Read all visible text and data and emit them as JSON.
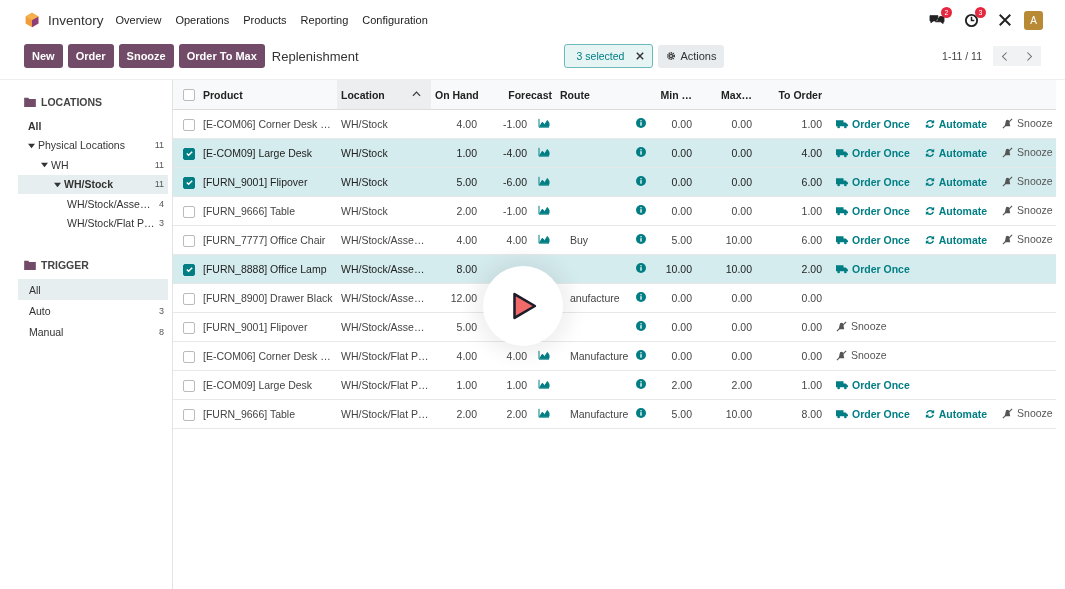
{
  "app": {
    "name": "Inventory"
  },
  "menu": [
    "Overview",
    "Operations",
    "Products",
    "Reporting",
    "Configuration"
  ],
  "systray": {
    "messages_badge": "2",
    "activities_badge": "3",
    "avatar": "A"
  },
  "toolbar": {
    "buttons": [
      "New",
      "Order",
      "Snooze",
      "Order To Max"
    ],
    "title": "Replenishment",
    "selection": "3 selected",
    "actions": "Actions",
    "pager": "1-11 / 11"
  },
  "sidebar": {
    "locations": {
      "title": "LOCATIONS",
      "items": [
        {
          "label": "All",
          "selected": false
        },
        {
          "label": "Physical Locations",
          "count": "11",
          "selected": false,
          "expanded": true,
          "children": [
            {
              "label": "WH",
              "count": "11",
              "selected": false,
              "expanded": true,
              "children": [
                {
                  "label": "WH/Stock",
                  "count": "11",
                  "selected": true,
                  "expanded": true,
                  "children": [
                    {
                      "label": "WH/Stock/Asse…",
                      "count": "4",
                      "selected": false
                    },
                    {
                      "label": "WH/Stock/Flat P…",
                      "count": "3",
                      "selected": false
                    }
                  ]
                }
              ]
            }
          ]
        }
      ]
    },
    "trigger": {
      "title": "TRIGGER",
      "items": [
        {
          "label": "All",
          "selected": true
        },
        {
          "label": "Auto",
          "count": "3",
          "selected": false
        },
        {
          "label": "Manual",
          "count": "8",
          "selected": false
        }
      ]
    }
  },
  "table": {
    "header_checked": false,
    "columns": [
      {
        "label": "Product",
        "sorted": false
      },
      {
        "label": "Location",
        "sorted": true
      },
      {
        "label": "On Hand",
        "sorted": false
      },
      {
        "label": "Forecast",
        "sorted": false
      },
      {
        "label": "Route",
        "sorted": false
      },
      {
        "label": "Min …",
        "sorted": false
      },
      {
        "label": "Max…",
        "sorted": false
      },
      {
        "label": "To Order",
        "sorted": false
      }
    ],
    "rows": [
      {
        "selected": false,
        "product": "[E-COM06] Corner Desk …",
        "location": "WH/Stock",
        "on_hand": "4.00",
        "forecast": "-1.00",
        "chart": true,
        "route": "",
        "min": "0.00",
        "max": "0.00",
        "to_order": "1.00",
        "order_once": "Order Once",
        "automate": "Automate",
        "snooze": "Snooze"
      },
      {
        "selected": true,
        "product": "[E-COM09] Large Desk",
        "location": "WH/Stock",
        "on_hand": "1.00",
        "forecast": "-4.00",
        "chart": true,
        "route": "",
        "min": "0.00",
        "max": "0.00",
        "to_order": "4.00",
        "order_once": "Order Once",
        "automate": "Automate",
        "snooze": "Snooze"
      },
      {
        "selected": true,
        "product": "[FURN_9001] Flipover",
        "location": "WH/Stock",
        "on_hand": "5.00",
        "forecast": "-6.00",
        "chart": true,
        "route": "",
        "min": "0.00",
        "max": "0.00",
        "to_order": "6.00",
        "order_once": "Order Once",
        "automate": "Automate",
        "snooze": "Snooze"
      },
      {
        "selected": false,
        "product": "[FURN_9666] Table",
        "location": "WH/Stock",
        "on_hand": "2.00",
        "forecast": "-1.00",
        "chart": true,
        "route": "",
        "min": "0.00",
        "max": "0.00",
        "to_order": "1.00",
        "order_once": "Order Once",
        "automate": "Automate",
        "snooze": "Snooze"
      },
      {
        "selected": false,
        "product": "[FURN_7777] Office Chair",
        "location": "WH/Stock/Asse…",
        "on_hand": "4.00",
        "forecast": "4.00",
        "chart": true,
        "route": "Buy",
        "min": "5.00",
        "max": "10.00",
        "to_order": "6.00",
        "order_once": "Order Once",
        "automate": "Automate",
        "snooze": "Snooze"
      },
      {
        "selected": true,
        "product": "[FURN_8888] Office Lamp",
        "location": "WH/Stock/Asse…",
        "on_hand": "8.00",
        "forecast": "",
        "chart": false,
        "route": "",
        "min": "10.00",
        "max": "10.00",
        "to_order": "2.00",
        "order_once": "Order Once",
        "automate": "",
        "snooze": ""
      },
      {
        "selected": false,
        "product": "[FURN_8900] Drawer Black",
        "location": "WH/Stock/Asse…",
        "on_hand": "12.00",
        "forecast": "",
        "chart": false,
        "route": "anufacture",
        "min": "0.00",
        "max": "0.00",
        "to_order": "0.00",
        "order_once": "",
        "automate": "",
        "snooze": ""
      },
      {
        "selected": false,
        "product": "[FURN_9001] Flipover",
        "location": "WH/Stock/Asse…",
        "on_hand": "5.00",
        "forecast": "",
        "chart": false,
        "route": "",
        "min": "0.00",
        "max": "0.00",
        "to_order": "0.00",
        "order_once": "",
        "automate": "",
        "snooze": "Snooze"
      },
      {
        "selected": false,
        "product": "[E-COM06] Corner Desk …",
        "location": "WH/Stock/Flat P…",
        "on_hand": "4.00",
        "forecast": "4.00",
        "chart": true,
        "route": "Manufacture",
        "min": "0.00",
        "max": "0.00",
        "to_order": "0.00",
        "order_once": "",
        "automate": "",
        "snooze": "Snooze"
      },
      {
        "selected": false,
        "product": "[E-COM09] Large Desk",
        "location": "WH/Stock/Flat P…",
        "on_hand": "1.00",
        "forecast": "1.00",
        "chart": true,
        "route": "",
        "min": "2.00",
        "max": "2.00",
        "to_order": "1.00",
        "order_once": "Order Once",
        "automate": "",
        "snooze": ""
      },
      {
        "selected": false,
        "product": "[FURN_9666] Table",
        "location": "WH/Stock/Flat P…",
        "on_hand": "2.00",
        "forecast": "2.00",
        "chart": true,
        "route": "Manufacture",
        "min": "5.00",
        "max": "10.00",
        "to_order": "8.00",
        "order_once": "Order Once",
        "automate": "Automate",
        "snooze": "Snooze"
      }
    ]
  }
}
